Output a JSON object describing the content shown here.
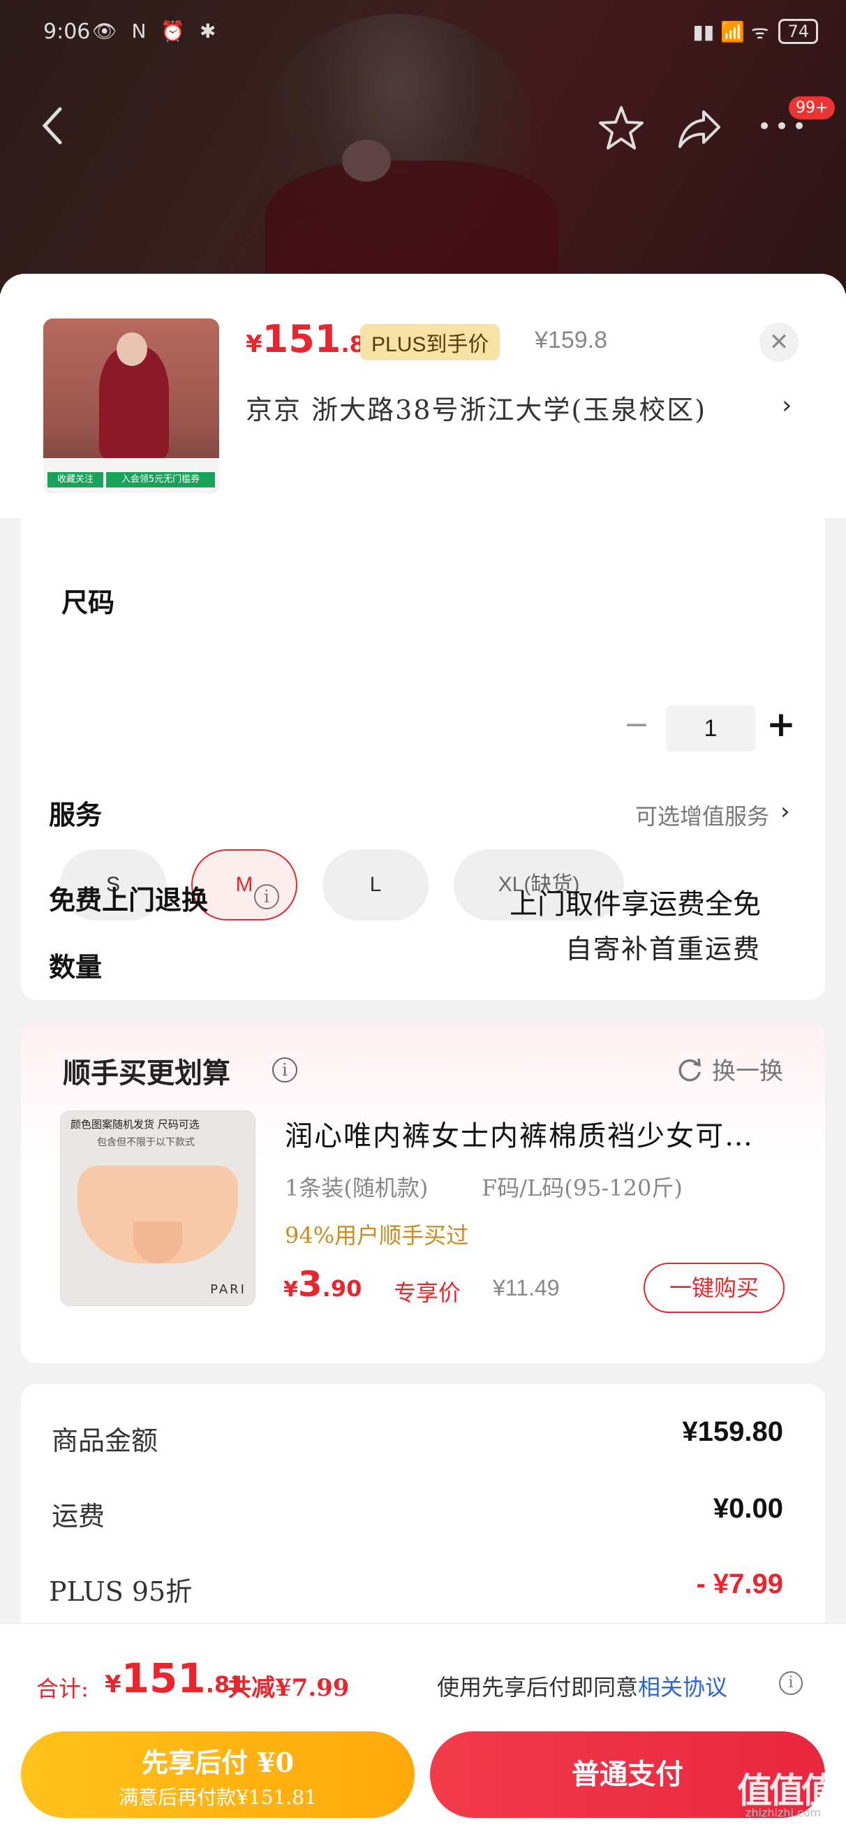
{
  "statusbar": {
    "time": "9:06",
    "icons": "👁 N ⏰ ✱",
    "signal": "▮▮ 📶 ᯤ",
    "battery": "74"
  },
  "navbar": {
    "badge": "99+"
  },
  "product": {
    "price_symbol": "¥",
    "price_int": "151",
    "price_dec": ".81",
    "plus_tag": "PLUS到手价",
    "original_price": "¥159.8",
    "address": "京京  浙大路38号浙江大学(玉泉校区)",
    "thumb_strip_a": "收藏关注",
    "thumb_strip_b": "入会领5元无门槛券"
  },
  "size": {
    "title": "尺码",
    "options": [
      {
        "label": "S",
        "state": "normal"
      },
      {
        "label": "M",
        "state": "selected"
      },
      {
        "label": "L",
        "state": "normal"
      },
      {
        "label": "XL(缺货)",
        "state": "out-of-stock"
      }
    ]
  },
  "quantity": {
    "label": "数量",
    "value": "1",
    "minus": "−",
    "plus": "+"
  },
  "service": {
    "label": "服务",
    "hint": "可选增值服务"
  },
  "returns": {
    "label": "免费上门退换",
    "main": "上门取件享运费全免",
    "sub": "自寄补首重运费"
  },
  "bundle": {
    "title": "顺手买更划算",
    "refresh": "换一换",
    "name": "润心唯内裤女士内裤棉质裆少女可…",
    "spec1": "1条装(随机款)",
    "spec2": "F码/L码(95-120斤)",
    "users": "94%用户顺手买过",
    "price_symbol": "¥",
    "price_int": "3",
    "price_dec": ".90",
    "price_tag": "专享价",
    "original_price": "¥11.49",
    "buy_label": "一键购买",
    "thumb_header": "颜色图案随机发货 尺码可选",
    "thumb_sub": "包含但不限于以下款式",
    "thumb_brand": "PARI"
  },
  "totals": {
    "rows": [
      {
        "label": "商品金额",
        "value": "¥159.80"
      },
      {
        "label": "运费",
        "value": "¥0.00"
      },
      {
        "label": "PLUS 95折",
        "value": "- ¥7.99"
      }
    ]
  },
  "footer": {
    "sum_label": "合计:",
    "sum_symbol": "¥",
    "sum_int": "151",
    "sum_dec": ".81",
    "sum_save": "共减¥7.99",
    "agree_text": "使用先享后付即同意",
    "agree_link": "相关协议",
    "later_title": "先享后付 ¥0",
    "later_sub": "满意后再付款¥151.81",
    "pay_label": "普通支付",
    "watermark": "值值值",
    "watermark_sub": "zhizhizhi.com"
  },
  "colors": {
    "accent": "#e8262d",
    "plus_tag_bg": "#f8e2a6",
    "later_btn": "#ffb414",
    "link": "#2b63d9"
  }
}
